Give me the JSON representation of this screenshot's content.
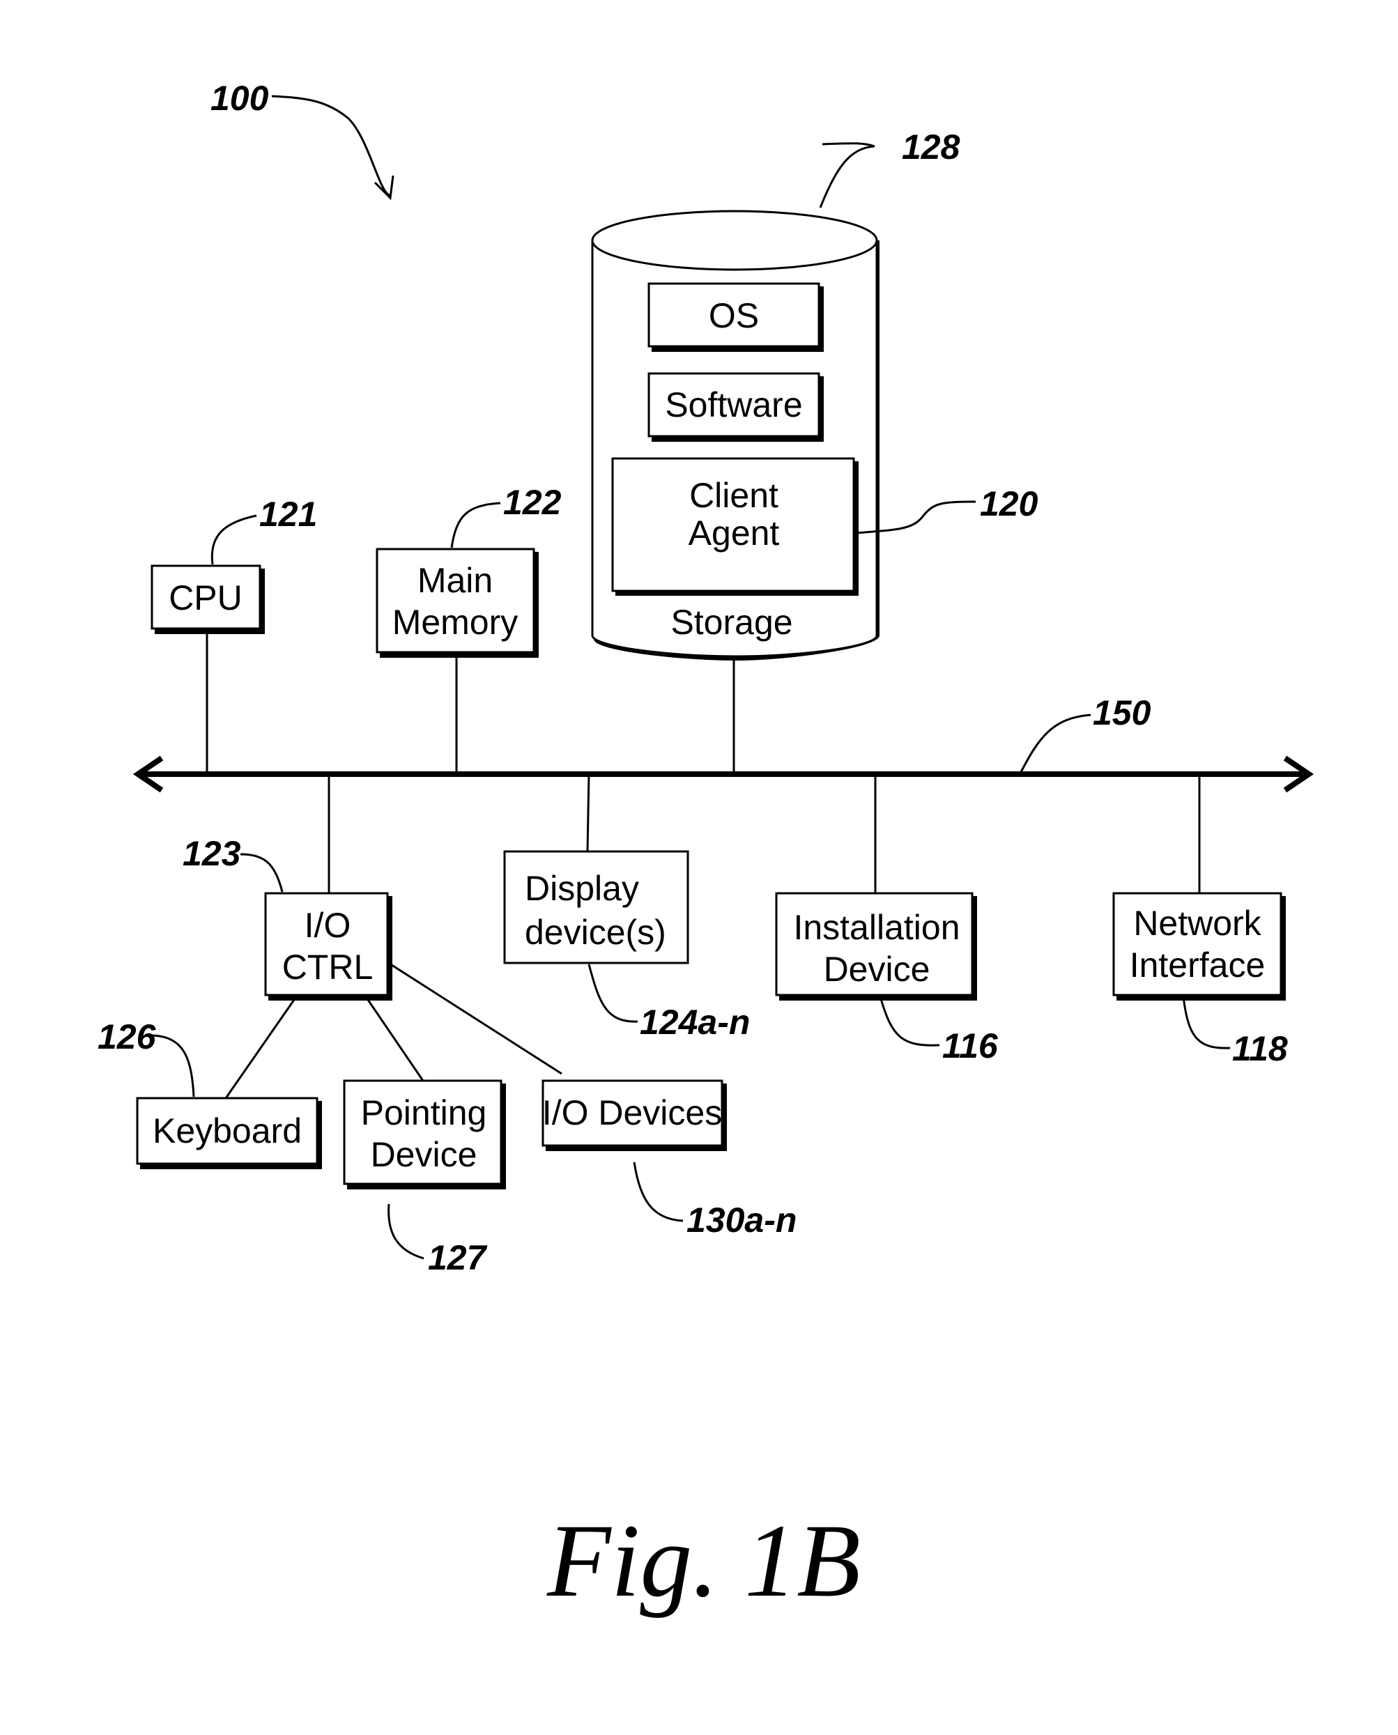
{
  "figure": {
    "caption": "Fig. 1B",
    "system_ref": "100"
  },
  "storage": {
    "label": "Storage",
    "ref": "128",
    "contents": {
      "os": "OS",
      "software": "Software",
      "client_agent_line1": "Client",
      "client_agent_line2": "Agent",
      "client_agent_ref": "120"
    }
  },
  "bus": {
    "ref": "150"
  },
  "components": {
    "cpu": {
      "label": "CPU",
      "ref": "121"
    },
    "main_memory": {
      "line1": "Main",
      "line2": "Memory",
      "ref": "122"
    },
    "io_ctrl": {
      "line1": "I/O",
      "line2": "CTRL",
      "ref": "123"
    },
    "display": {
      "line1": "Display",
      "line2": "device(s)",
      "ref": "124a-n"
    },
    "installation": {
      "line1": "Installation",
      "line2": "Device",
      "ref": "116"
    },
    "network": {
      "line1": "Network",
      "line2": "Interface",
      "ref": "118"
    },
    "keyboard": {
      "label": "Keyboard",
      "ref": "126"
    },
    "pointing": {
      "line1": "Pointing",
      "line2": "Device",
      "ref": "127"
    },
    "io_devices": {
      "label": "I/O Devices",
      "ref": "130a-n"
    }
  }
}
